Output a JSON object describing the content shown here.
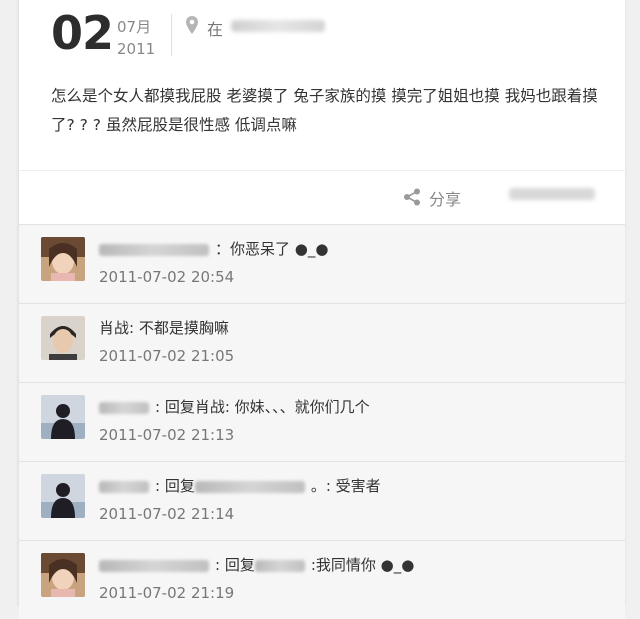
{
  "post": {
    "day": "02",
    "month": "07月",
    "year": "2011",
    "location_label": "在",
    "text": "怎么是个女人都摸我屁股 老婆摸了 兔子家族的摸 摸完了姐姐也摸 我妈也跟着摸了? ? ?  虽然屁股是很性感 低调点嘛"
  },
  "share": {
    "label": "分享"
  },
  "comments": [
    {
      "text": "：你恶呆了 ●_●",
      "time": "2011-07-02 20:54",
      "avatar": "girl"
    },
    {
      "name": "肖战",
      "text": ": 不都是摸胸嘛",
      "time": "2011-07-02 21:05",
      "avatar": "boy"
    },
    {
      "text": ": 回复肖战: 你妹、、、就你们几个",
      "time": "2011-07-02 21:13",
      "avatar": "silhouette"
    },
    {
      "text": ": 回复",
      "text2": "。: 受害者",
      "time": "2011-07-02 21:14",
      "avatar": "silhouette"
    },
    {
      "text": ": 回复",
      "text2": ":我同情你 ●_●",
      "time": "2011-07-02 21:19",
      "avatar": "girl"
    }
  ]
}
